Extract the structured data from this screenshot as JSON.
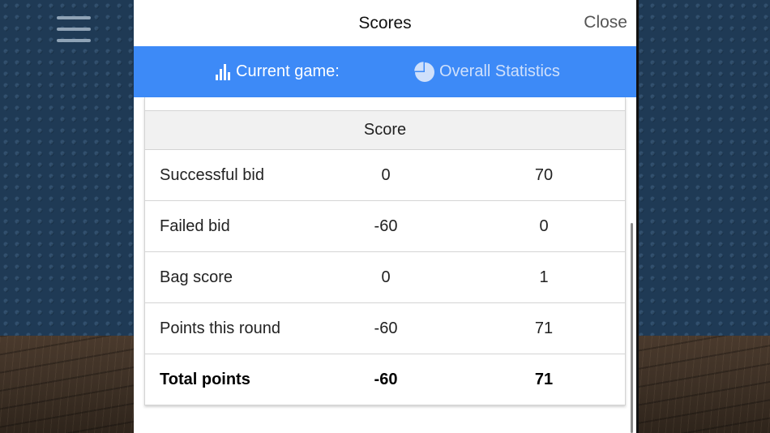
{
  "header": {
    "title": "Scores",
    "close_label": "Close"
  },
  "tabs": [
    {
      "label": "Current game:",
      "icon": "bar-chart-icon",
      "active": true
    },
    {
      "label": "Overall Statistics",
      "icon": "pie-chart-icon",
      "active": false
    }
  ],
  "table": {
    "header": "Score",
    "rows": [
      {
        "label": "Successful bid",
        "a": "0",
        "b": "70"
      },
      {
        "label": "Failed bid",
        "a": "-60",
        "b": "0"
      },
      {
        "label": "Bag score",
        "a": "0",
        "b": "1"
      },
      {
        "label": "Points this round",
        "a": "-60",
        "b": "71"
      },
      {
        "label": "Total points",
        "a": "-60",
        "b": "71"
      }
    ]
  },
  "colors": {
    "tab_bar": "#3d8af7",
    "background_wall": "#1f3a55",
    "floor": "#3d3025"
  },
  "menu_icon": "hamburger-icon"
}
